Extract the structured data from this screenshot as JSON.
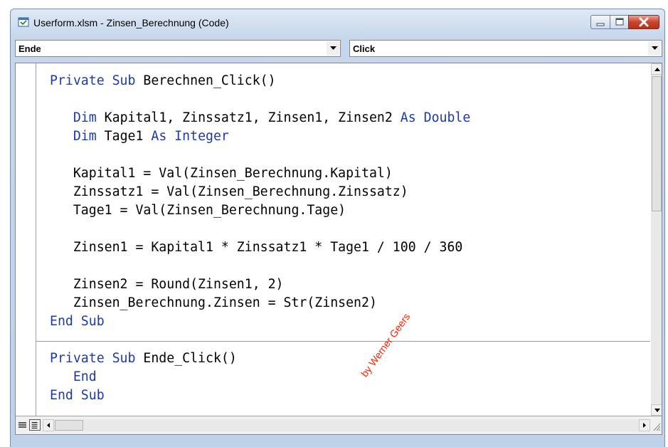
{
  "window": {
    "title": "Userform.xlsm - Zinsen_Berechnung (Code)"
  },
  "combos": {
    "object": "Ende",
    "procedure": "Click"
  },
  "code": {
    "lines": [
      [
        {
          "t": "Private Sub",
          "k": true
        },
        {
          "t": " Berechnen_Click()"
        }
      ],
      [],
      [
        {
          "t": "   "
        },
        {
          "t": "Dim",
          "k": true
        },
        {
          "t": " Kapital1, Zinssatz1, Zinsen1, Zinsen2 "
        },
        {
          "t": "As Double",
          "k": true
        }
      ],
      [
        {
          "t": "   "
        },
        {
          "t": "Dim",
          "k": true
        },
        {
          "t": " Tage1 "
        },
        {
          "t": "As Integer",
          "k": true
        }
      ],
      [],
      [
        {
          "t": "   Kapital1 = Val(Zinsen_Berechnung.Kapital)"
        }
      ],
      [
        {
          "t": "   Zinssatz1 = Val(Zinsen_Berechnung.Zinssatz)"
        }
      ],
      [
        {
          "t": "   Tage1 = Val(Zinsen_Berechnung.Tage)"
        }
      ],
      [],
      [
        {
          "t": "   Zinsen1 = Kapital1 * Zinssatz1 * Tage1 / 100 / 360"
        }
      ],
      [],
      [
        {
          "t": "   Zinsen2 = Round(Zinsen1, 2)"
        }
      ],
      [
        {
          "t": "   Zinsen_Berechnung.Zinsen = Str(Zinsen2)"
        }
      ],
      [
        {
          "t": "End Sub",
          "k": true
        }
      ],
      [],
      [
        {
          "t": "Private Sub",
          "k": true
        },
        {
          "t": " Ende_Click()"
        }
      ],
      [
        {
          "t": "   "
        },
        {
          "t": "End",
          "k": true
        }
      ],
      [
        {
          "t": "End Sub",
          "k": true
        }
      ]
    ]
  },
  "watermark": "by Werner Geers",
  "colors": {
    "keyword": "#1c3aa9",
    "text": "#000000",
    "watermark": "#ff2200"
  }
}
